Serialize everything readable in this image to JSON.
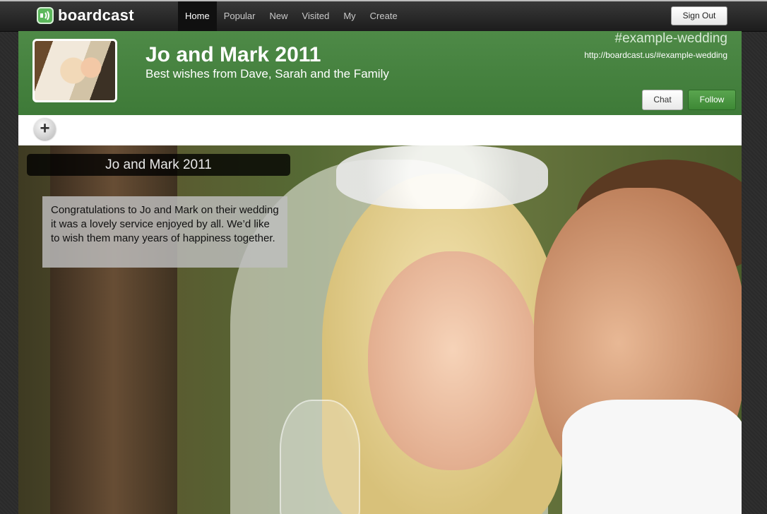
{
  "brand": {
    "name": "boardcast",
    "accent": "#5cb85c"
  },
  "nav": {
    "items": [
      {
        "label": "Home",
        "active": true
      },
      {
        "label": "Popular"
      },
      {
        "label": "New"
      },
      {
        "label": "Visited"
      },
      {
        "label": "My"
      },
      {
        "label": "Create"
      }
    ],
    "sign_out": "Sign Out"
  },
  "board": {
    "title": "Jo and Mark 2011",
    "subtitle": "Best wishes from Dave, Sarah and the Family",
    "hashtag": "#example-wedding",
    "url": "http://boardcast.us/#example-wedding",
    "header_color": "#457f3f",
    "chat_label": "Chat",
    "follow_label": "Follow",
    "add_icon": "plus-icon"
  },
  "content": {
    "photo_title": "Jo and Mark 2011",
    "message": "Congratulations to Jo and Mark on their wedding it was a lovely service enjoyed by all. We’d like to wish them many years of happiness together."
  }
}
